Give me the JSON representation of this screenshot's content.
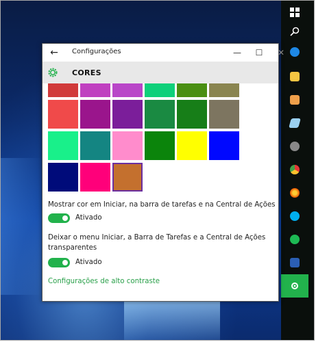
{
  "window": {
    "title": "Configurações",
    "back_icon": "back-arrow-icon",
    "minimize_icon": "minimize-icon",
    "maximize_icon": "maximize-icon",
    "close_icon": "close-icon"
  },
  "header": {
    "icon": "gear-icon",
    "title": "CORES"
  },
  "swatches": {
    "rows": [
      [
        "#d13a3a",
        "#c040c0",
        "#b946c8",
        "#0ed07a",
        "#4a8f12",
        "#8a8550"
      ],
      [
        "#f04a4a",
        "#9a158c",
        "#7b1e9a",
        "#1a8a42",
        "#177e18",
        "#7d7560"
      ],
      [
        "#19f08a",
        "#148582",
        "#ff8ccc",
        "#0b840b",
        "#ffff00",
        "#0008ff"
      ],
      [
        "#000b7a",
        "#ff007a",
        "#c4702e"
      ]
    ],
    "selected": "#c4702e"
  },
  "settings": {
    "show_color_label": "Mostrar cor em Iniciar, na barra de tarefas e na Central de Ações",
    "show_color_toggle": "Ativado",
    "transparency_label_line1": "Deixar o menu Iniciar, a Barra de Tarefas e a Central de Ações",
    "transparency_label_line2": "transparentes",
    "transparency_toggle": "Ativado",
    "high_contrast_link": "Configurações de alto contraste"
  },
  "taskbar": {
    "accent": "#22b24c",
    "items": [
      "windows-icon",
      "search-icon",
      "edge-icon",
      "file-explorer-icon",
      "media-icon",
      "app-icon",
      "settings-icon",
      "chrome-icon",
      "firefox-icon",
      "skype-icon",
      "spotify-icon",
      "word-icon",
      "settings-icon"
    ]
  }
}
